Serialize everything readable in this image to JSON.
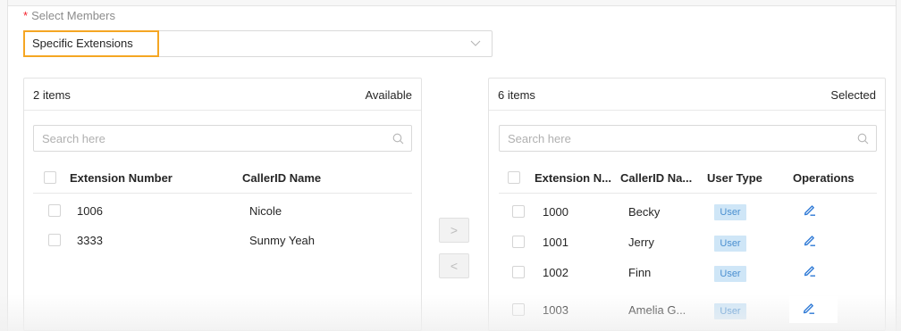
{
  "form": {
    "required_mark": "*",
    "label": "Select Members",
    "select_value": "Specific Extensions"
  },
  "available": {
    "count": "2 items",
    "title": "Available",
    "search_placeholder": "Search here",
    "columns": [
      "Extension Number",
      "CallerID Name"
    ],
    "rows": [
      {
        "ext": "1006",
        "name": "Nicole"
      },
      {
        "ext": "3333",
        "name": "Sunmy Yeah"
      }
    ]
  },
  "selected": {
    "count": "6 items",
    "title": "Selected",
    "search_placeholder": "Search here",
    "columns": [
      "Extension N...",
      "CallerID Na...",
      "User Type",
      "Operations"
    ],
    "rows": [
      {
        "ext": "1000",
        "name": "Becky",
        "type": "User"
      },
      {
        "ext": "1001",
        "name": "Jerry",
        "type": "User"
      },
      {
        "ext": "1002",
        "name": "Finn",
        "type": "User"
      },
      {
        "ext": "1003",
        "name": "Amelia G...",
        "type": "User"
      }
    ]
  },
  "transfer": {
    "to_right": ">",
    "to_left": "<"
  },
  "colors": {
    "required": "#f5222d",
    "highlight": "#f5a623",
    "link": "#2f7ad6",
    "badge_bg": "#cfe6f7",
    "badge_text": "#4a8fd0"
  },
  "icons": {
    "select": "chevron-down-icon",
    "search": "search-icon",
    "edit": "edit-icon"
  }
}
